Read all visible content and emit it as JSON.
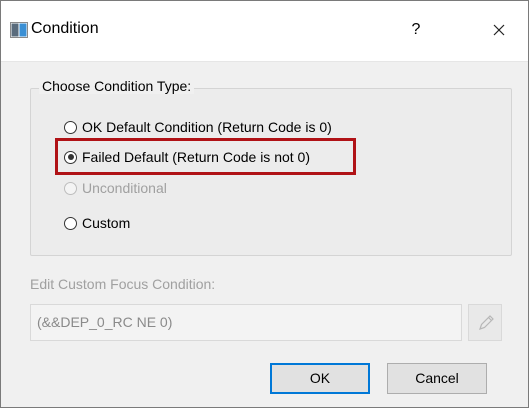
{
  "window": {
    "title": "Condition",
    "help_label": "?",
    "close_icon": "close-icon",
    "app_icon": "dialog-app-icon"
  },
  "group": {
    "title": "Choose Condition Type:",
    "options": [
      {
        "label": "OK Default Condition (Return Code is 0)",
        "checked": false,
        "enabled": true
      },
      {
        "label": "Failed Default (Return Code is not 0)",
        "checked": true,
        "enabled": true,
        "highlighted": true
      },
      {
        "label": "Unconditional",
        "checked": false,
        "enabled": false
      },
      {
        "label": "Custom",
        "checked": false,
        "enabled": true
      }
    ]
  },
  "custom": {
    "label": "Edit Custom Focus Condition:",
    "value": "(&&DEP_0_RC NE 0)",
    "edit_icon": "pencil-icon"
  },
  "buttons": {
    "ok": "OK",
    "cancel": "Cancel"
  },
  "colors": {
    "highlight": "#b01216",
    "default_button_border": "#0078d7"
  }
}
